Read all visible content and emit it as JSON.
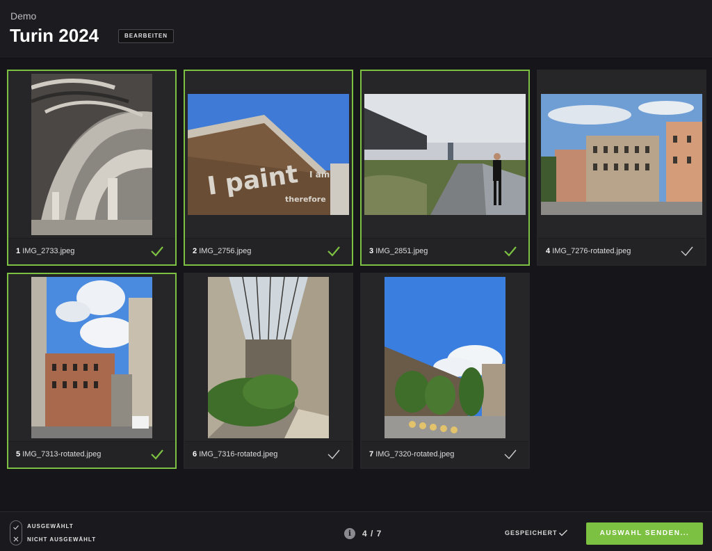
{
  "header": {
    "breadcrumb": "Demo",
    "title": "Turin 2024",
    "edit_label": "BEARBEITEN"
  },
  "photos": [
    {
      "index": "1",
      "filename": "IMG_2733.jpeg",
      "selected": true
    },
    {
      "index": "2",
      "filename": "IMG_2756.jpeg",
      "selected": true
    },
    {
      "index": "3",
      "filename": "IMG_2851.jpeg",
      "selected": true
    },
    {
      "index": "4",
      "filename": "IMG_7276-rotated.jpeg",
      "selected": false
    },
    {
      "index": "5",
      "filename": "IMG_7313-rotated.jpeg",
      "selected": true
    },
    {
      "index": "6",
      "filename": "IMG_7316-rotated.jpeg",
      "selected": false
    },
    {
      "index": "7",
      "filename": "IMG_7320-rotated.jpeg",
      "selected": false
    }
  ],
  "footer": {
    "legend_selected": "AUSGEWÄHLT",
    "legend_not_selected": "NICHT AUSGEWÄHLT",
    "counter": "4 / 7",
    "saved_label": "GESPEICHERT",
    "send_label": "AUSWAHL SENDEN..."
  },
  "colors": {
    "accent": "#7dc142",
    "unselected_check": "#cfcfcf"
  },
  "icons": {
    "info": "info-icon",
    "check": "check-icon",
    "close": "close-icon"
  }
}
